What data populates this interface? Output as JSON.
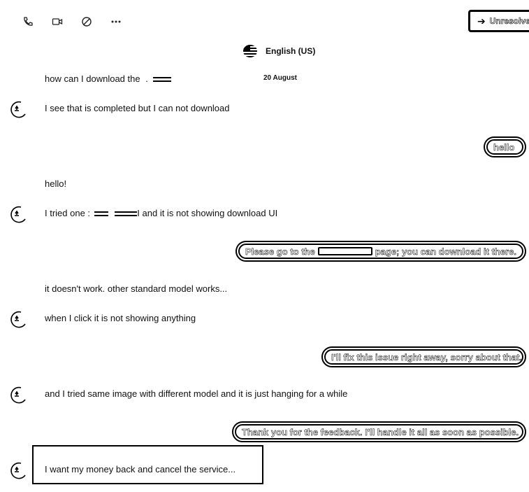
{
  "toolbar": {
    "icons": [
      "phone-icon",
      "video-icon",
      "block-icon",
      "more-icon"
    ],
    "status_button_label": "Unresolved"
  },
  "language": "English (US)",
  "date_label": "20 August",
  "messages": [
    {
      "from": "user",
      "text_before": "how can I download the",
      "text_after": ""
    },
    {
      "from": "user",
      "text": "I see that is completed but I can not download"
    },
    {
      "from": "agent",
      "text": "hello"
    },
    {
      "from": "user",
      "text": "hello!"
    },
    {
      "from": "user",
      "text_before": "I tried one :",
      "text_after": "I and it is not showing download UI"
    },
    {
      "from": "agent",
      "text_before": "Please go to the",
      "text_after": "page; you can download it there."
    },
    {
      "from": "user",
      "text": "it doesn't work. other standard model works..."
    },
    {
      "from": "user",
      "text": "when I click it is not showing anything"
    },
    {
      "from": "agent",
      "text": "I'll fix this issue right away, sorry about that."
    },
    {
      "from": "user",
      "text": "and I tried same image with different model and it is just hanging for a while"
    },
    {
      "from": "agent",
      "text": "Thank you for the feedback. I'll handle it all as soon as possible."
    },
    {
      "from": "user",
      "text": "I want my money back and cancel the service..."
    }
  ]
}
